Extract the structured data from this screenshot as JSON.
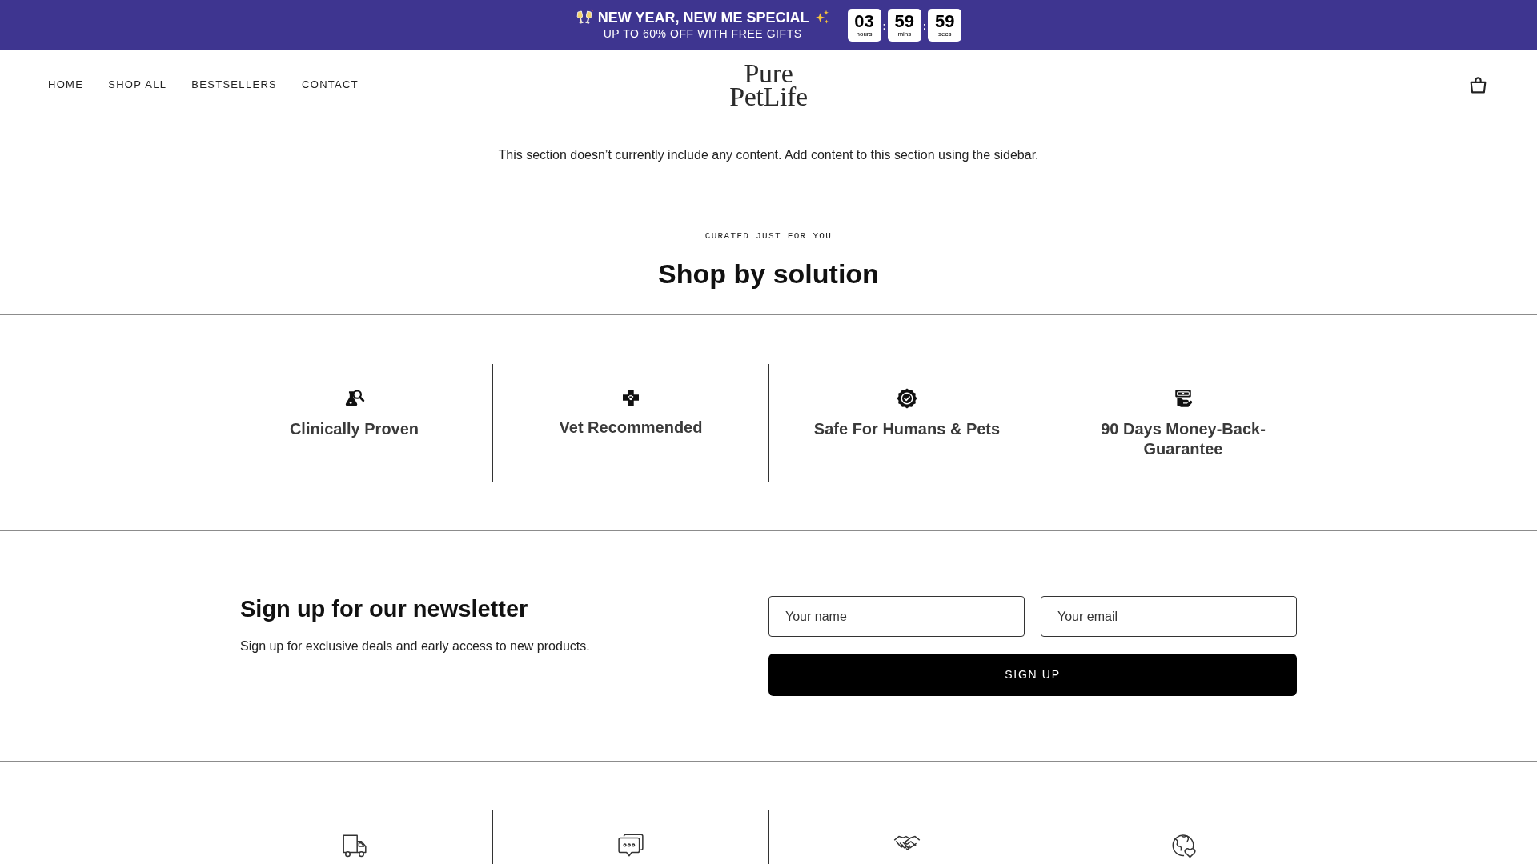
{
  "announcement": {
    "title": "NEW YEAR, NEW ME SPECIAL",
    "subtitle": "UP TO 60% OFF WITH FREE GIFTS",
    "countdown": [
      {
        "kind": "unit",
        "value": "03",
        "label": "hours"
      },
      {
        "kind": "separator",
        "text": ":"
      },
      {
        "kind": "unit",
        "value": "59",
        "label": "mins"
      },
      {
        "kind": "separator",
        "text": ":"
      },
      {
        "kind": "unit",
        "value": "59",
        "label": "secs"
      }
    ]
  },
  "header": {
    "nav": [
      "HOME",
      "SHOP ALL",
      "BESTSELLERS",
      "CONTACT"
    ],
    "logo": [
      "Pure",
      "PetLife"
    ]
  },
  "notice": "This section doesn’t currently include any content. Add content to this section using the sidebar.",
  "solutions": {
    "eyebrow": "CURATED JUST FOR YOU",
    "title": "Shop by solution",
    "items": [
      "Clinically Proven",
      "Vet Recommended",
      "Safe For Humans & Pets",
      "90 Days Money-Back-Guarantee"
    ]
  },
  "newsletter": {
    "title": "Sign up for our newsletter",
    "text": "Sign up for exclusive deals and early access to new products.",
    "fields": [
      {
        "placeholder": "Your name"
      },
      {
        "placeholder": "Your email"
      }
    ],
    "button": "SIGN UP"
  }
}
